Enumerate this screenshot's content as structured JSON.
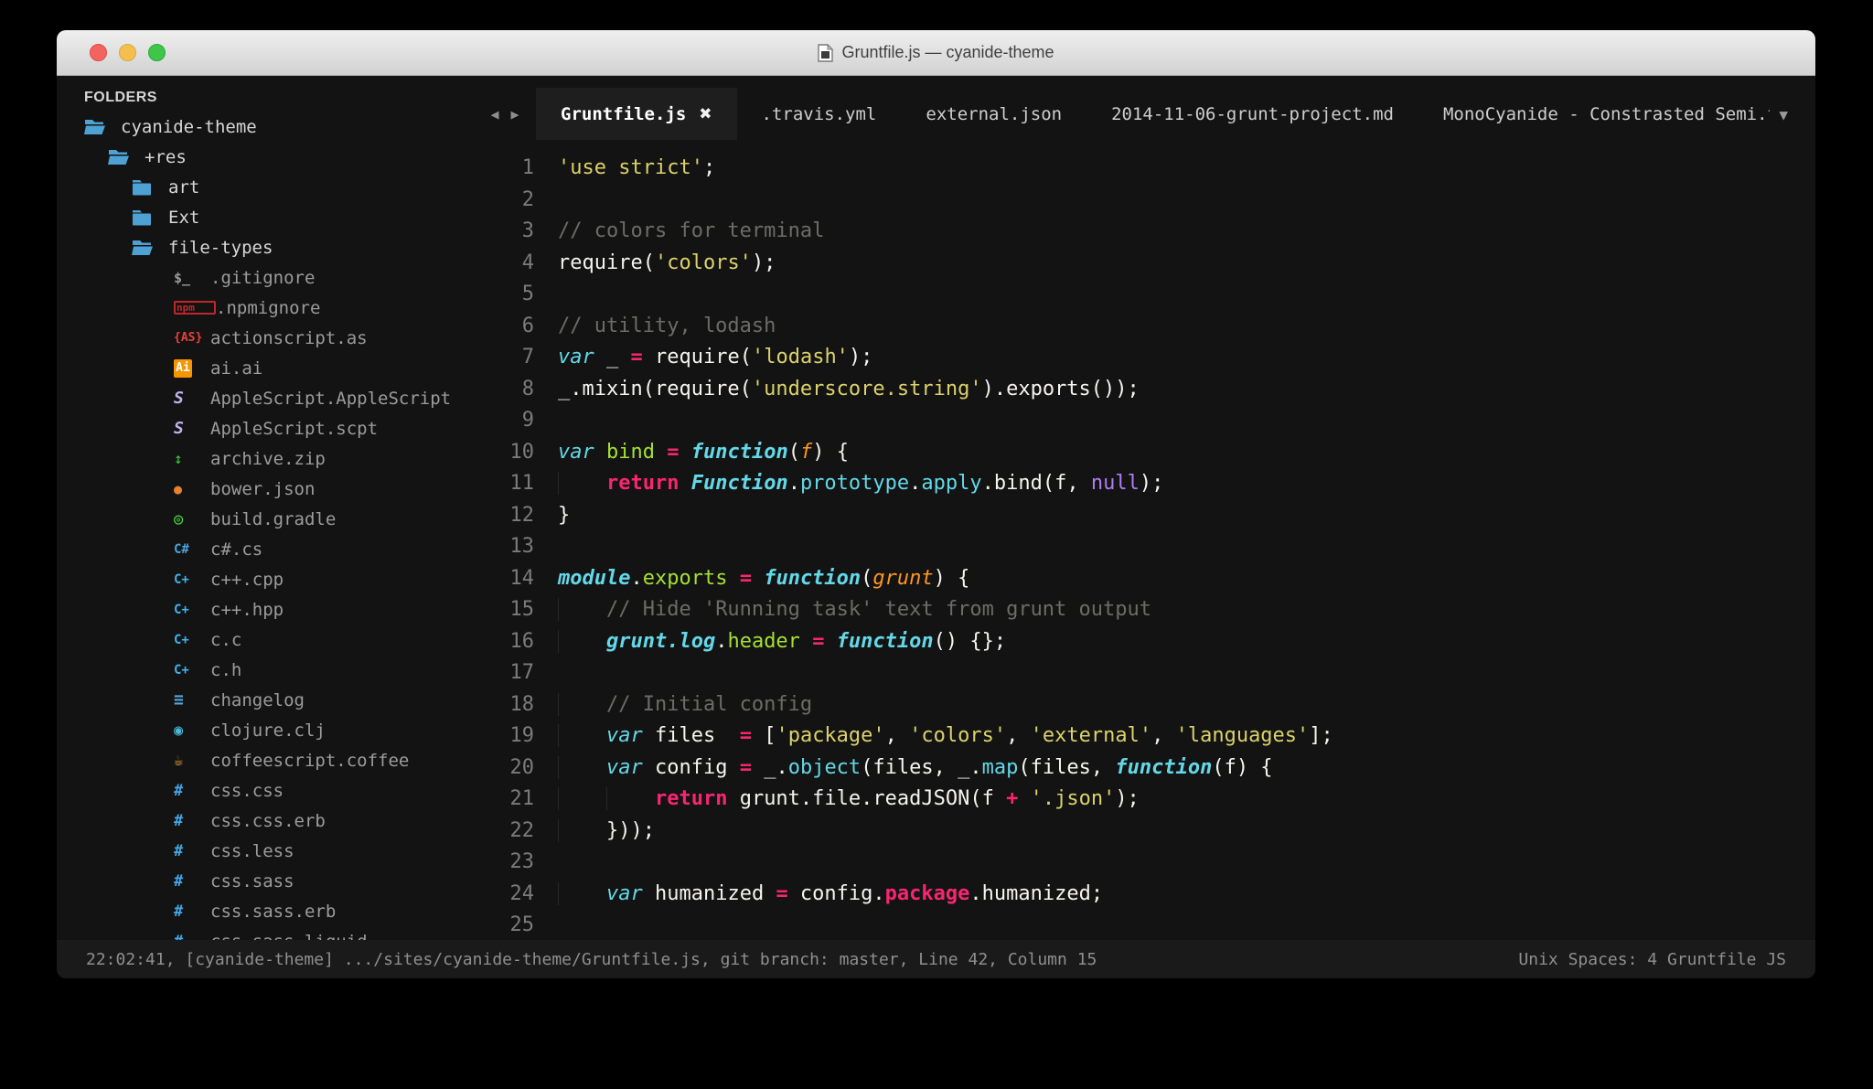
{
  "window": {
    "title": "Gruntfile.js — cyanide-theme"
  },
  "sidebar": {
    "header": "FOLDERS",
    "items": [
      {
        "label": "cyanide-theme",
        "type": "folder",
        "icon": "folder-open-icon",
        "indent": 0
      },
      {
        "label": "+res",
        "type": "folder",
        "icon": "folder-open-icon",
        "indent": 1
      },
      {
        "label": "art",
        "type": "folder",
        "icon": "folder-closed-icon",
        "indent": 2
      },
      {
        "label": "Ext",
        "type": "folder",
        "icon": "folder-closed-icon",
        "indent": 2
      },
      {
        "label": "file-types",
        "type": "folder",
        "icon": "folder-open-icon",
        "indent": 2
      },
      {
        "label": ".gitignore",
        "type": "file",
        "icon": "terminal-icon",
        "indent": 3
      },
      {
        "label": ".npmignore",
        "type": "file",
        "icon": "npm-icon",
        "indent": 3
      },
      {
        "label": "actionscript.as",
        "type": "file",
        "icon": "as-icon",
        "indent": 3
      },
      {
        "label": "ai.ai",
        "type": "file",
        "icon": "ai-icon",
        "indent": 3
      },
      {
        "label": "AppleScript.AppleScript",
        "type": "file",
        "icon": "applescript-icon",
        "indent": 3
      },
      {
        "label": "AppleScript.scpt",
        "type": "file",
        "icon": "applescript-icon",
        "indent": 3
      },
      {
        "label": "archive.zip",
        "type": "file",
        "icon": "zip-icon",
        "indent": 3
      },
      {
        "label": "bower.json",
        "type": "file",
        "icon": "bower-icon",
        "indent": 3
      },
      {
        "label": "build.gradle",
        "type": "file",
        "icon": "gradle-icon",
        "indent": 3
      },
      {
        "label": "c#.cs",
        "type": "file",
        "icon": "csharp-icon",
        "indent": 3
      },
      {
        "label": "c++.cpp",
        "type": "file",
        "icon": "cpp-icon",
        "indent": 3
      },
      {
        "label": "c++.hpp",
        "type": "file",
        "icon": "cpp-icon",
        "indent": 3
      },
      {
        "label": "c.c",
        "type": "file",
        "icon": "cpp-icon",
        "indent": 3
      },
      {
        "label": "c.h",
        "type": "file",
        "icon": "cpp-icon",
        "indent": 3
      },
      {
        "label": "changelog",
        "type": "file",
        "icon": "changelog-icon",
        "indent": 3
      },
      {
        "label": "clojure.clj",
        "type": "file",
        "icon": "clojure-icon",
        "indent": 3
      },
      {
        "label": "coffeescript.coffee",
        "type": "file",
        "icon": "coffee-icon",
        "indent": 3
      },
      {
        "label": "css.css",
        "type": "file",
        "icon": "css-icon",
        "indent": 3
      },
      {
        "label": "css.css.erb",
        "type": "file",
        "icon": "css-icon",
        "indent": 3
      },
      {
        "label": "css.less",
        "type": "file",
        "icon": "css-icon",
        "indent": 3
      },
      {
        "label": "css.sass",
        "type": "file",
        "icon": "css-icon",
        "indent": 3
      },
      {
        "label": "css.sass.erb",
        "type": "file",
        "icon": "css-icon",
        "indent": 3
      },
      {
        "label": "css.sass.liquid",
        "type": "file",
        "icon": "css-icon",
        "indent": 3
      }
    ]
  },
  "icon_glyphs": {
    "terminal-icon": "$_",
    "npm-icon": "npm",
    "as-icon": "{AS}",
    "ai-icon": "Ai",
    "applescript-icon": "S",
    "zip-icon": "↕",
    "bower-icon": "●",
    "gradle-icon": "◎",
    "csharp-icon": "C#",
    "cpp-icon": "C+",
    "changelog-icon": "≡",
    "clojure-icon": "◉",
    "coffee-icon": "☕",
    "css-icon": "#"
  },
  "tabbar": {
    "back_arrow": "◀",
    "forward_arrow": "▶",
    "overflow_arrow": "▼",
    "tabs": [
      {
        "label": "Gruntfile.js",
        "active": true,
        "close_glyph": "✖"
      },
      {
        "label": ".travis.yml",
        "active": false
      },
      {
        "label": "external.json",
        "active": false
      },
      {
        "label": "2014-11-06-grunt-project.md",
        "active": false
      },
      {
        "label": "MonoCyanide - Constrasted Semi.tmTheme",
        "active": false
      }
    ]
  },
  "editor": {
    "lines": [
      {
        "n": 1,
        "t": [
          [
            "y",
            "'use strict'"
          ],
          [
            "w",
            ";"
          ]
        ]
      },
      {
        "n": 2,
        "t": []
      },
      {
        "n": 3,
        "t": [
          [
            "m",
            "// colors for terminal"
          ]
        ]
      },
      {
        "n": 4,
        "t": [
          [
            "w",
            "require("
          ],
          [
            "y",
            "'colors'"
          ],
          [
            "w",
            ");"
          ]
        ]
      },
      {
        "n": 5,
        "t": []
      },
      {
        "n": 6,
        "t": [
          [
            "m",
            "// utility, lodash"
          ]
        ]
      },
      {
        "n": 7,
        "t": [
          [
            "k",
            "var"
          ],
          [
            "w",
            " _ "
          ],
          [
            "p",
            "="
          ],
          [
            "w",
            " require("
          ],
          [
            "y",
            "'lodash'"
          ],
          [
            "w",
            ");"
          ]
        ]
      },
      {
        "n": 8,
        "t": [
          [
            "w",
            "_.mixin(require("
          ],
          [
            "y",
            "'underscore.string'"
          ],
          [
            "w",
            ").exports());"
          ]
        ]
      },
      {
        "n": 9,
        "t": []
      },
      {
        "n": 10,
        "t": [
          [
            "k",
            "var"
          ],
          [
            "w",
            " "
          ],
          [
            "g",
            "bind"
          ],
          [
            "w",
            " "
          ],
          [
            "p",
            "="
          ],
          [
            "w",
            " "
          ],
          [
            "kb",
            "function"
          ],
          [
            "w",
            "("
          ],
          [
            "o",
            "f"
          ],
          [
            "w",
            ") {"
          ]
        ]
      },
      {
        "n": 11,
        "t": [
          [
            "w",
            "    "
          ],
          [
            "p",
            "return"
          ],
          [
            "w",
            " "
          ],
          [
            "kb",
            "Function"
          ],
          [
            "w",
            "."
          ],
          [
            "c",
            "prototype"
          ],
          [
            "w",
            "."
          ],
          [
            "c",
            "apply"
          ],
          [
            "w",
            ".bind(f, "
          ],
          [
            "pu",
            "null"
          ],
          [
            "w",
            ");"
          ]
        ]
      },
      {
        "n": 12,
        "t": [
          [
            "w",
            "}"
          ]
        ]
      },
      {
        "n": 13,
        "t": []
      },
      {
        "n": 14,
        "t": [
          [
            "kb",
            "module"
          ],
          [
            "w",
            "."
          ],
          [
            "g",
            "exports"
          ],
          [
            "w",
            " "
          ],
          [
            "p",
            "="
          ],
          [
            "w",
            " "
          ],
          [
            "kb",
            "function"
          ],
          [
            "w",
            "("
          ],
          [
            "o",
            "grunt"
          ],
          [
            "w",
            ") {"
          ]
        ]
      },
      {
        "n": 15,
        "t": [
          [
            "w",
            "    "
          ],
          [
            "m",
            "// Hide 'Running task' text from grunt output"
          ]
        ]
      },
      {
        "n": 16,
        "t": [
          [
            "w",
            "    "
          ],
          [
            "kb",
            "grunt.log"
          ],
          [
            "w",
            "."
          ],
          [
            "g",
            "header"
          ],
          [
            "w",
            " "
          ],
          [
            "p",
            "="
          ],
          [
            "w",
            " "
          ],
          [
            "kb",
            "function"
          ],
          [
            "w",
            "() {};"
          ]
        ]
      },
      {
        "n": 17,
        "t": []
      },
      {
        "n": 18,
        "t": [
          [
            "w",
            "    "
          ],
          [
            "m",
            "// Initial config"
          ]
        ]
      },
      {
        "n": 19,
        "t": [
          [
            "w",
            "    "
          ],
          [
            "k",
            "var"
          ],
          [
            "w",
            " files  "
          ],
          [
            "p",
            "="
          ],
          [
            "w",
            " ["
          ],
          [
            "y",
            "'package'"
          ],
          [
            "w",
            ", "
          ],
          [
            "y",
            "'colors'"
          ],
          [
            "w",
            ", "
          ],
          [
            "y",
            "'external'"
          ],
          [
            "w",
            ", "
          ],
          [
            "y",
            "'languages'"
          ],
          [
            "w",
            "];"
          ]
        ]
      },
      {
        "n": 20,
        "t": [
          [
            "w",
            "    "
          ],
          [
            "k",
            "var"
          ],
          [
            "w",
            " config "
          ],
          [
            "p",
            "="
          ],
          [
            "w",
            " _."
          ],
          [
            "c",
            "object"
          ],
          [
            "w",
            "(files, _."
          ],
          [
            "c",
            "map"
          ],
          [
            "w",
            "(files, "
          ],
          [
            "kb",
            "function"
          ],
          [
            "w",
            "(f) {"
          ]
        ]
      },
      {
        "n": 21,
        "t": [
          [
            "w",
            "        "
          ],
          [
            "p",
            "return"
          ],
          [
            "w",
            " grunt.file.readJSON(f "
          ],
          [
            "p",
            "+"
          ],
          [
            "w",
            " "
          ],
          [
            "y",
            "'.json'"
          ],
          [
            "w",
            ");"
          ]
        ]
      },
      {
        "n": 22,
        "t": [
          [
            "w",
            "    }));"
          ]
        ]
      },
      {
        "n": 23,
        "t": []
      },
      {
        "n": 24,
        "t": [
          [
            "w",
            "    "
          ],
          [
            "k",
            "var"
          ],
          [
            "w",
            " humanized "
          ],
          [
            "p",
            "="
          ],
          [
            "w",
            " config."
          ],
          [
            "p",
            "package"
          ],
          [
            "w",
            ".humanized;"
          ]
        ]
      },
      {
        "n": 25,
        "t": []
      }
    ]
  },
  "statusbar": {
    "left": "22:02:41, [cyanide-theme] .../sites/cyanide-theme/Gruntfile.js, git branch: master, Line 42, Column 15",
    "right": "Unix Spaces: 4 Gruntfile JS"
  },
  "theme": {
    "background": "#131313",
    "active_tab": "#1e1e1e",
    "folder_blue": "#4ea1d3",
    "string_yellow": "#dcd26b",
    "keyword_cyan": "#62d8e8",
    "operator_pink": "#f7266f",
    "definition_green": "#a5e132",
    "param_orange": "#fd9721",
    "null_purple": "#b07cf4",
    "comment_gray": "#6c6c66"
  }
}
